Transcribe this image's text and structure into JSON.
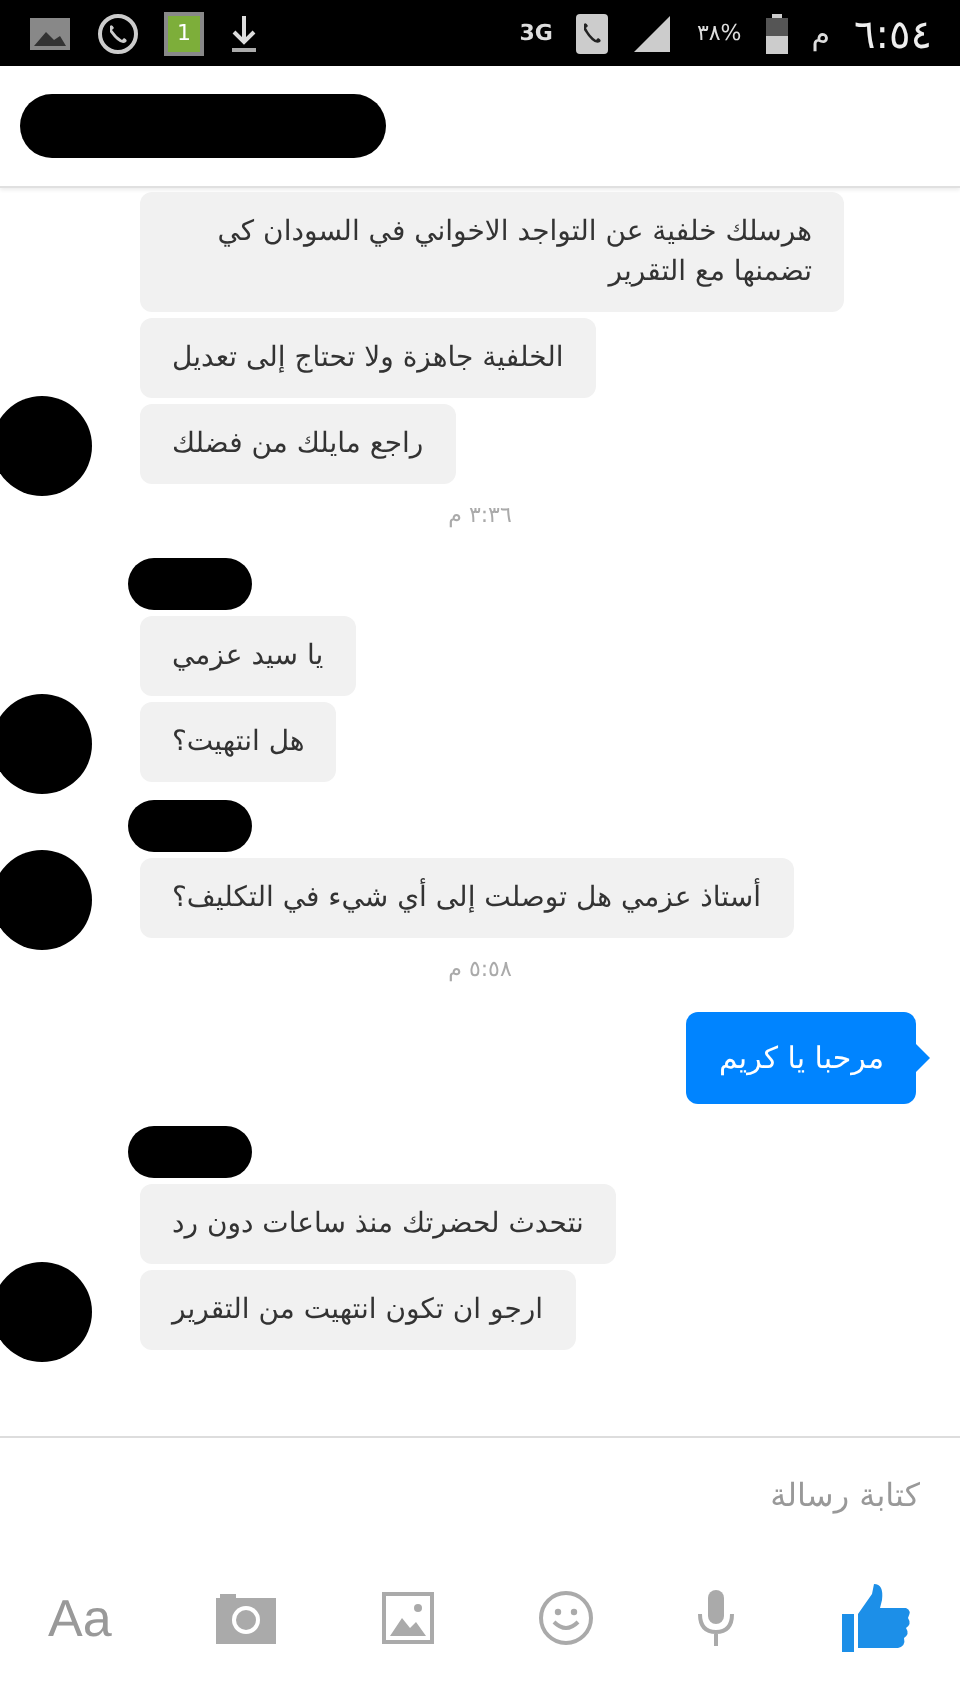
{
  "status_bar": {
    "notification_badge": "1",
    "network": "3G",
    "battery_percent": "٣٨%",
    "am_pm": "م",
    "time": "٦:٥٤"
  },
  "header": {
    "title_redacted": true
  },
  "messages": [
    {
      "kind": "received",
      "text": "هرسلك خلفية عن التواجد الاخواني في السودان كي تضمنها مع التقرير",
      "avatar": false
    },
    {
      "kind": "received",
      "text": "الخلفية جاهزة ولا تحتاج إلى تعديل",
      "avatar": false
    },
    {
      "kind": "received",
      "text": "راجع مايلك من فضلك",
      "avatar": true
    },
    {
      "kind": "timestamp",
      "text": "٣:٣٦ م"
    },
    {
      "kind": "name_hidden"
    },
    {
      "kind": "received",
      "text": "يا سيد عزمي",
      "avatar": false
    },
    {
      "kind": "received",
      "text": "هل انتهيت؟",
      "avatar": true
    },
    {
      "kind": "name_hidden"
    },
    {
      "kind": "received",
      "text": "أستاذ عزمي هل توصلت إلى أي شيء في التكليف؟",
      "avatar": true
    },
    {
      "kind": "timestamp",
      "text": "٥:٥٨ م"
    },
    {
      "kind": "sent",
      "text": "مرحبا يا كريم"
    },
    {
      "kind": "name_hidden"
    },
    {
      "kind": "received",
      "text": "نتحدث لحضرتك منذ ساعات دون رد",
      "avatar": false
    },
    {
      "kind": "received",
      "text": "ارجو ان تكون انتهيت من التقرير",
      "avatar": true
    }
  ],
  "composer": {
    "placeholder": "كتابة رسالة"
  },
  "toolbar": {
    "text_button": "Aa"
  }
}
